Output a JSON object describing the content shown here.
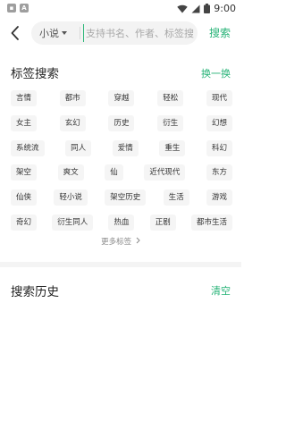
{
  "status_bar": {
    "time": "9:00",
    "icons": [
      "notification-box-icon",
      "a-box-icon",
      "wifi-icon",
      "signal-icon",
      "battery-icon"
    ]
  },
  "search": {
    "type_label": "小说",
    "placeholder": "支持书名、作者、标签搜索",
    "button_label": "搜索"
  },
  "tag_section": {
    "title": "标签搜索",
    "action": "换一换",
    "rows": [
      [
        "言情",
        "都市",
        "穿越",
        "轻松",
        "现代"
      ],
      [
        "女主",
        "玄幻",
        "历史",
        "衍生",
        "幻想"
      ],
      [
        "系统流",
        "同人",
        "爱情",
        "重生",
        "科幻"
      ],
      [
        "架空",
        "爽文",
        "仙",
        "近代现代",
        "东方"
      ],
      [
        "仙侠",
        "轻小说",
        "架空历史",
        "生活",
        "游戏"
      ],
      [
        "奇幻",
        "衍生同人",
        "热血",
        "正剧",
        "都市生活"
      ]
    ],
    "more": "更多标签"
  },
  "history_section": {
    "title": "搜索历史",
    "action": "清空"
  },
  "colors": {
    "accent": "#27b377",
    "tag_bg": "#f5f5f5",
    "search_bg": "#f3f3f3"
  }
}
